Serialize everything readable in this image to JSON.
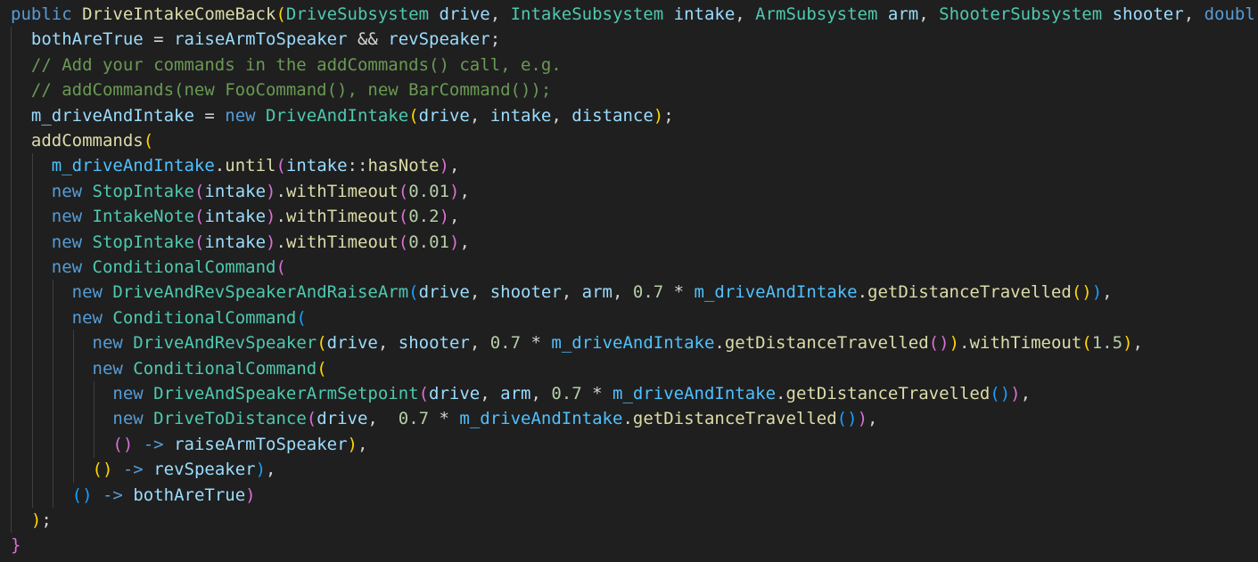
{
  "editor": {
    "colors": {
      "background": "#1f1f1f",
      "keyword": "#569cd6",
      "function": "#dcdcaa",
      "type": "#4ec9b0",
      "variable": "#9cdcfe",
      "field": "#4fc1ff",
      "number": "#b5cea8",
      "comment": "#6a9955",
      "bracket_1": "#ffd700",
      "bracket_2": "#da70d6",
      "bracket_3": "#179fff"
    },
    "lines": [
      [
        [
          "kw",
          "public"
        ],
        [
          "p",
          " "
        ],
        [
          "fn",
          "DriveIntakeComeBack"
        ],
        [
          "b1",
          "("
        ],
        [
          "type",
          "DriveSubsystem"
        ],
        [
          "p",
          " "
        ],
        [
          "var",
          "drive"
        ],
        [
          "p",
          ", "
        ],
        [
          "type",
          "IntakeSubsystem"
        ],
        [
          "p",
          " "
        ],
        [
          "var",
          "intake"
        ],
        [
          "p",
          ", "
        ],
        [
          "type",
          "ArmSubsystem"
        ],
        [
          "p",
          " "
        ],
        [
          "var",
          "arm"
        ],
        [
          "p",
          ", "
        ],
        [
          "type",
          "ShooterSubsystem"
        ],
        [
          "p",
          " "
        ],
        [
          "var",
          "shooter"
        ],
        [
          "p",
          ", "
        ],
        [
          "kw",
          "doubl"
        ]
      ],
      [
        [
          "p",
          "  "
        ],
        [
          "var",
          "bothAreTrue"
        ],
        [
          "p",
          " = "
        ],
        [
          "var",
          "raiseArmToSpeaker"
        ],
        [
          "p",
          " && "
        ],
        [
          "var",
          "revSpeaker"
        ],
        [
          "p",
          ";"
        ]
      ],
      [
        [
          "p",
          "  "
        ],
        [
          "com",
          "// Add your commands in the addCommands() call, e.g."
        ]
      ],
      [
        [
          "p",
          "  "
        ],
        [
          "com",
          "// addCommands(new FooCommand(), new BarCommand());"
        ]
      ],
      [
        [
          "p",
          "  "
        ],
        [
          "var",
          "m_driveAndIntake"
        ],
        [
          "p",
          " = "
        ],
        [
          "kw",
          "new"
        ],
        [
          "p",
          " "
        ],
        [
          "type",
          "DriveAndIntake"
        ],
        [
          "b1",
          "("
        ],
        [
          "var",
          "drive"
        ],
        [
          "p",
          ", "
        ],
        [
          "var",
          "intake"
        ],
        [
          "p",
          ", "
        ],
        [
          "var",
          "distance"
        ],
        [
          "b1",
          ")"
        ],
        [
          "p",
          ";"
        ]
      ],
      [
        [
          "p",
          "  "
        ],
        [
          "fn",
          "addCommands"
        ],
        [
          "b1",
          "("
        ]
      ],
      [
        [
          "p",
          "    "
        ],
        [
          "field",
          "m_driveAndIntake"
        ],
        [
          "p",
          "."
        ],
        [
          "fn",
          "until"
        ],
        [
          "b2",
          "("
        ],
        [
          "var",
          "intake"
        ],
        [
          "p",
          "::"
        ],
        [
          "fn",
          "hasNote"
        ],
        [
          "b2",
          ")"
        ],
        [
          "p",
          ","
        ]
      ],
      [
        [
          "p",
          "    "
        ],
        [
          "kw",
          "new"
        ],
        [
          "p",
          " "
        ],
        [
          "type",
          "StopIntake"
        ],
        [
          "b2",
          "("
        ],
        [
          "var",
          "intake"
        ],
        [
          "b2",
          ")"
        ],
        [
          "p",
          "."
        ],
        [
          "fn",
          "withTimeout"
        ],
        [
          "b2",
          "("
        ],
        [
          "num",
          "0.01"
        ],
        [
          "b2",
          ")"
        ],
        [
          "p",
          ","
        ]
      ],
      [
        [
          "p",
          "    "
        ],
        [
          "kw",
          "new"
        ],
        [
          "p",
          " "
        ],
        [
          "type",
          "IntakeNote"
        ],
        [
          "b2",
          "("
        ],
        [
          "var",
          "intake"
        ],
        [
          "b2",
          ")"
        ],
        [
          "p",
          "."
        ],
        [
          "fn",
          "withTimeout"
        ],
        [
          "b2",
          "("
        ],
        [
          "num",
          "0.2"
        ],
        [
          "b2",
          ")"
        ],
        [
          "p",
          ","
        ]
      ],
      [
        [
          "p",
          "    "
        ],
        [
          "kw",
          "new"
        ],
        [
          "p",
          " "
        ],
        [
          "type",
          "StopIntake"
        ],
        [
          "b2",
          "("
        ],
        [
          "var",
          "intake"
        ],
        [
          "b2",
          ")"
        ],
        [
          "p",
          "."
        ],
        [
          "fn",
          "withTimeout"
        ],
        [
          "b2",
          "("
        ],
        [
          "num",
          "0.01"
        ],
        [
          "b2",
          ")"
        ],
        [
          "p",
          ","
        ]
      ],
      [
        [
          "p",
          "    "
        ],
        [
          "kw",
          "new"
        ],
        [
          "p",
          " "
        ],
        [
          "type",
          "ConditionalCommand"
        ],
        [
          "b2",
          "("
        ]
      ],
      [
        [
          "p",
          "      "
        ],
        [
          "kw",
          "new"
        ],
        [
          "p",
          " "
        ],
        [
          "type",
          "DriveAndRevSpeakerAndRaiseArm"
        ],
        [
          "b3",
          "("
        ],
        [
          "var",
          "drive"
        ],
        [
          "p",
          ", "
        ],
        [
          "var",
          "shooter"
        ],
        [
          "p",
          ", "
        ],
        [
          "var",
          "arm"
        ],
        [
          "p",
          ", "
        ],
        [
          "num",
          "0.7"
        ],
        [
          "p",
          " * "
        ],
        [
          "field",
          "m_driveAndIntake"
        ],
        [
          "p",
          "."
        ],
        [
          "fn",
          "getDistanceTravelled"
        ],
        [
          "b1",
          "()"
        ],
        [
          "b3",
          ")"
        ],
        [
          "p",
          ","
        ]
      ],
      [
        [
          "p",
          "      "
        ],
        [
          "kw",
          "new"
        ],
        [
          "p",
          " "
        ],
        [
          "type",
          "ConditionalCommand"
        ],
        [
          "b3",
          "("
        ]
      ],
      [
        [
          "p",
          "        "
        ],
        [
          "kw",
          "new"
        ],
        [
          "p",
          " "
        ],
        [
          "type",
          "DriveAndRevSpeaker"
        ],
        [
          "b1",
          "("
        ],
        [
          "var",
          "drive"
        ],
        [
          "p",
          ", "
        ],
        [
          "var",
          "shooter"
        ],
        [
          "p",
          ", "
        ],
        [
          "num",
          "0.7"
        ],
        [
          "p",
          " * "
        ],
        [
          "field",
          "m_driveAndIntake"
        ],
        [
          "p",
          "."
        ],
        [
          "fn",
          "getDistanceTravelled"
        ],
        [
          "b2",
          "()"
        ],
        [
          "b1",
          ")"
        ],
        [
          "p",
          "."
        ],
        [
          "fn",
          "withTimeout"
        ],
        [
          "b1",
          "("
        ],
        [
          "num",
          "1.5"
        ],
        [
          "b1",
          ")"
        ],
        [
          "p",
          ","
        ]
      ],
      [
        [
          "p",
          "        "
        ],
        [
          "kw",
          "new"
        ],
        [
          "p",
          " "
        ],
        [
          "type",
          "ConditionalCommand"
        ],
        [
          "b1",
          "("
        ]
      ],
      [
        [
          "p",
          "          "
        ],
        [
          "kw",
          "new"
        ],
        [
          "p",
          " "
        ],
        [
          "type",
          "DriveAndSpeakerArmSetpoint"
        ],
        [
          "b2",
          "("
        ],
        [
          "var",
          "drive"
        ],
        [
          "p",
          ", "
        ],
        [
          "var",
          "arm"
        ],
        [
          "p",
          ", "
        ],
        [
          "num",
          "0.7"
        ],
        [
          "p",
          " * "
        ],
        [
          "field",
          "m_driveAndIntake"
        ],
        [
          "p",
          "."
        ],
        [
          "fn",
          "getDistanceTravelled"
        ],
        [
          "b3",
          "()"
        ],
        [
          "b2",
          ")"
        ],
        [
          "p",
          ","
        ]
      ],
      [
        [
          "p",
          "          "
        ],
        [
          "kw",
          "new"
        ],
        [
          "p",
          " "
        ],
        [
          "type",
          "DriveToDistance"
        ],
        [
          "b2",
          "("
        ],
        [
          "var",
          "drive"
        ],
        [
          "p",
          ",  "
        ],
        [
          "num",
          "0.7"
        ],
        [
          "p",
          " * "
        ],
        [
          "field",
          "m_driveAndIntake"
        ],
        [
          "p",
          "."
        ],
        [
          "fn",
          "getDistanceTravelled"
        ],
        [
          "b3",
          "()"
        ],
        [
          "b2",
          ")"
        ],
        [
          "p",
          ","
        ]
      ],
      [
        [
          "p",
          "          "
        ],
        [
          "b2",
          "()"
        ],
        [
          "p",
          " "
        ],
        [
          "arrow",
          "->"
        ],
        [
          "p",
          " "
        ],
        [
          "var",
          "raiseArmToSpeaker"
        ],
        [
          "b1",
          ")"
        ],
        [
          "p",
          ","
        ]
      ],
      [
        [
          "p",
          "        "
        ],
        [
          "b1",
          "()"
        ],
        [
          "p",
          " "
        ],
        [
          "arrow",
          "->"
        ],
        [
          "p",
          " "
        ],
        [
          "var",
          "revSpeaker"
        ],
        [
          "b3",
          ")"
        ],
        [
          "p",
          ","
        ]
      ],
      [
        [
          "p",
          "      "
        ],
        [
          "b3",
          "()"
        ],
        [
          "p",
          " "
        ],
        [
          "arrow",
          "->"
        ],
        [
          "p",
          " "
        ],
        [
          "var",
          "bothAreTrue"
        ],
        [
          "b2",
          ")"
        ]
      ],
      [
        [
          "p",
          "  "
        ],
        [
          "b1",
          ")"
        ],
        [
          "p",
          ";"
        ]
      ],
      [
        [
          "b2",
          "}"
        ]
      ]
    ]
  }
}
